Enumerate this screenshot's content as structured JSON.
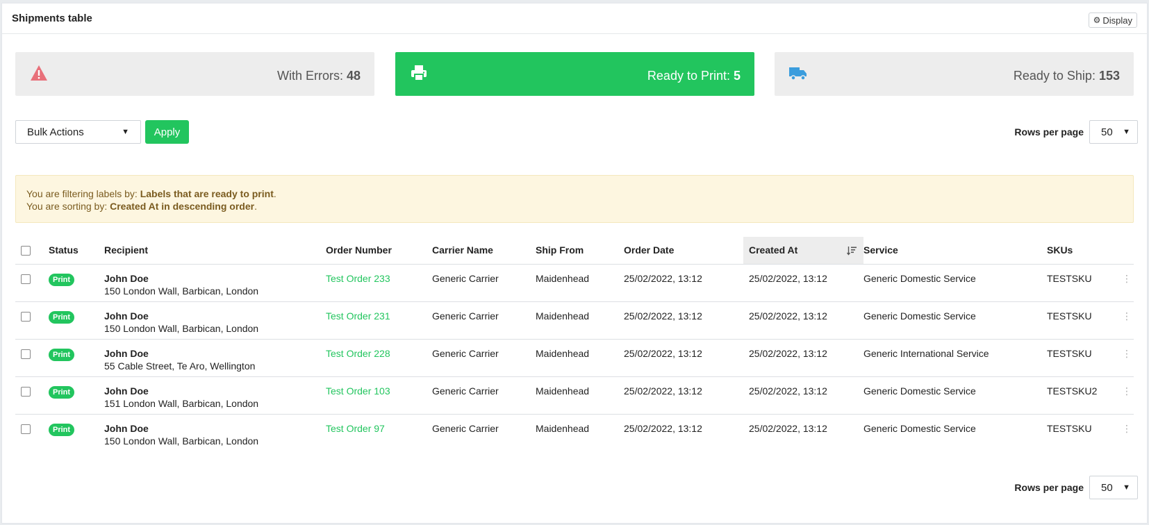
{
  "header": {
    "title": "Shipments table",
    "display_label": "Display"
  },
  "stats": {
    "errors": {
      "label": "With Errors: ",
      "count": "48"
    },
    "print": {
      "label": "Ready to Print: ",
      "count": "5"
    },
    "ship": {
      "label": "Ready to Ship: ",
      "count": "153"
    }
  },
  "toolbar": {
    "bulk_actions": "Bulk Actions",
    "apply": "Apply",
    "rows_label": "Rows per page",
    "rows_value": "50"
  },
  "notice": {
    "line1_prefix": "You are filtering labels by: ",
    "line1_value": "Labels that are ready to print",
    "line2_prefix": "You are sorting by: ",
    "line2_value": "Created At in descending order",
    "suffix": "."
  },
  "table": {
    "columns": {
      "status": "Status",
      "recipient": "Recipient",
      "order": "Order Number",
      "carrier": "Carrier Name",
      "ship_from": "Ship From",
      "order_date": "Order Date",
      "created_at": "Created At",
      "service": "Service",
      "skus": "SKUs"
    },
    "rows": [
      {
        "status": "Print",
        "name": "John Doe",
        "address": "150 London Wall, Barbican, London",
        "order": "Test Order 233",
        "carrier": "Generic Carrier",
        "ship_from": "Maidenhead",
        "order_date": "25/02/2022, 13:12",
        "created_at": "25/02/2022, 13:12",
        "service": "Generic Domestic Service",
        "sku": "TESTSKU"
      },
      {
        "status": "Print",
        "name": "John Doe",
        "address": "150 London Wall, Barbican, London",
        "order": "Test Order 231",
        "carrier": "Generic Carrier",
        "ship_from": "Maidenhead",
        "order_date": "25/02/2022, 13:12",
        "created_at": "25/02/2022, 13:12",
        "service": "Generic Domestic Service",
        "sku": "TESTSKU"
      },
      {
        "status": "Print",
        "name": "John Doe",
        "address": "55 Cable Street, Te Aro, Wellington",
        "order": "Test Order 228",
        "carrier": "Generic Carrier",
        "ship_from": "Maidenhead",
        "order_date": "25/02/2022, 13:12",
        "created_at": "25/02/2022, 13:12",
        "service": "Generic International Service",
        "sku": "TESTSKU"
      },
      {
        "status": "Print",
        "name": "John Doe",
        "address": "151 London Wall, Barbican, London",
        "order": "Test Order 103",
        "carrier": "Generic Carrier",
        "ship_from": "Maidenhead",
        "order_date": "25/02/2022, 13:12",
        "created_at": "25/02/2022, 13:12",
        "service": "Generic Domestic Service",
        "sku": "TESTSKU2"
      },
      {
        "status": "Print",
        "name": "John Doe",
        "address": "150 London Wall, Barbican, London",
        "order": "Test Order 97",
        "carrier": "Generic Carrier",
        "ship_from": "Maidenhead",
        "order_date": "25/02/2022, 13:12",
        "created_at": "25/02/2022, 13:12",
        "service": "Generic Domestic Service",
        "sku": "TESTSKU"
      }
    ]
  },
  "colors": {
    "accent": "#22c55e",
    "error": "#e8707a",
    "ship": "#3b9ddd",
    "notice_bg": "#fdf6e0"
  },
  "icons": {
    "errors": "warning-icon",
    "print": "printer-icon",
    "ship": "truck-icon",
    "display": "gear-icon",
    "sort": "sort-desc-icon",
    "row_menu": "kebab-icon"
  }
}
